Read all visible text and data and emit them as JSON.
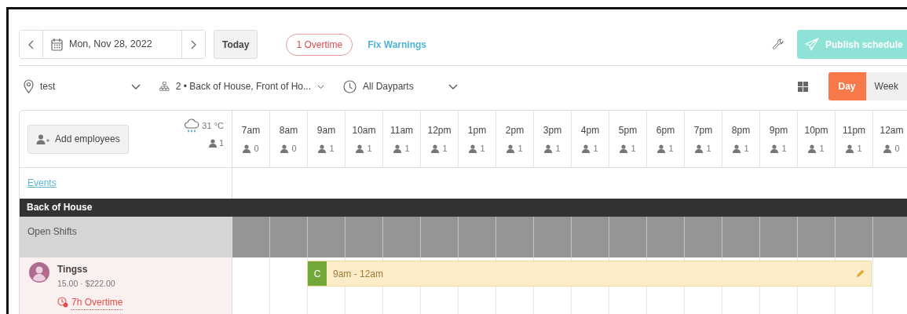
{
  "date_nav": {
    "date": "Mon, Nov 28, 2022"
  },
  "today_button": "Today",
  "warnings": {
    "overtime": "1 Overtime",
    "fix": "Fix Warnings"
  },
  "publish_button": "Publish schedule",
  "filters": [
    {
      "kind": "location",
      "label": "test"
    },
    {
      "kind": "departments",
      "label": "2 • Back of House, Front of Ho..."
    },
    {
      "kind": "dayparts",
      "label": "All Dayparts"
    }
  ],
  "view_toggle": [
    {
      "label": "Day",
      "selected": true
    },
    {
      "label": "Week",
      "selected": false
    }
  ],
  "add_employees": "Add employees",
  "weather": {
    "temperature": "31 °C",
    "staff_count": "1"
  },
  "hours": [
    {
      "label": "7am",
      "count": "0"
    },
    {
      "label": "8am",
      "count": "0"
    },
    {
      "label": "9am",
      "count": "1"
    },
    {
      "label": "10am",
      "count": "1"
    },
    {
      "label": "11am",
      "count": "1"
    },
    {
      "label": "12pm",
      "count": "1"
    },
    {
      "label": "1pm",
      "count": "1"
    },
    {
      "label": "2pm",
      "count": "1"
    },
    {
      "label": "3pm",
      "count": "1"
    },
    {
      "label": "4pm",
      "count": "1"
    },
    {
      "label": "5pm",
      "count": "1"
    },
    {
      "label": "6pm",
      "count": "1"
    },
    {
      "label": "7pm",
      "count": "1"
    },
    {
      "label": "8pm",
      "count": "1"
    },
    {
      "label": "9pm",
      "count": "1"
    },
    {
      "label": "10pm",
      "count": "1"
    },
    {
      "label": "11pm",
      "count": "1"
    },
    {
      "label": "12am",
      "count": "0"
    }
  ],
  "events_label": "Events",
  "section": "Back of House",
  "open_shifts_label": "Open Shifts",
  "employees": [
    {
      "name": "Tingss",
      "pay": "15.00 · $222.00",
      "overtime": "7h Overtime",
      "shifts": [
        {
          "badge": "C",
          "time": "9am - 12am"
        }
      ]
    }
  ]
}
